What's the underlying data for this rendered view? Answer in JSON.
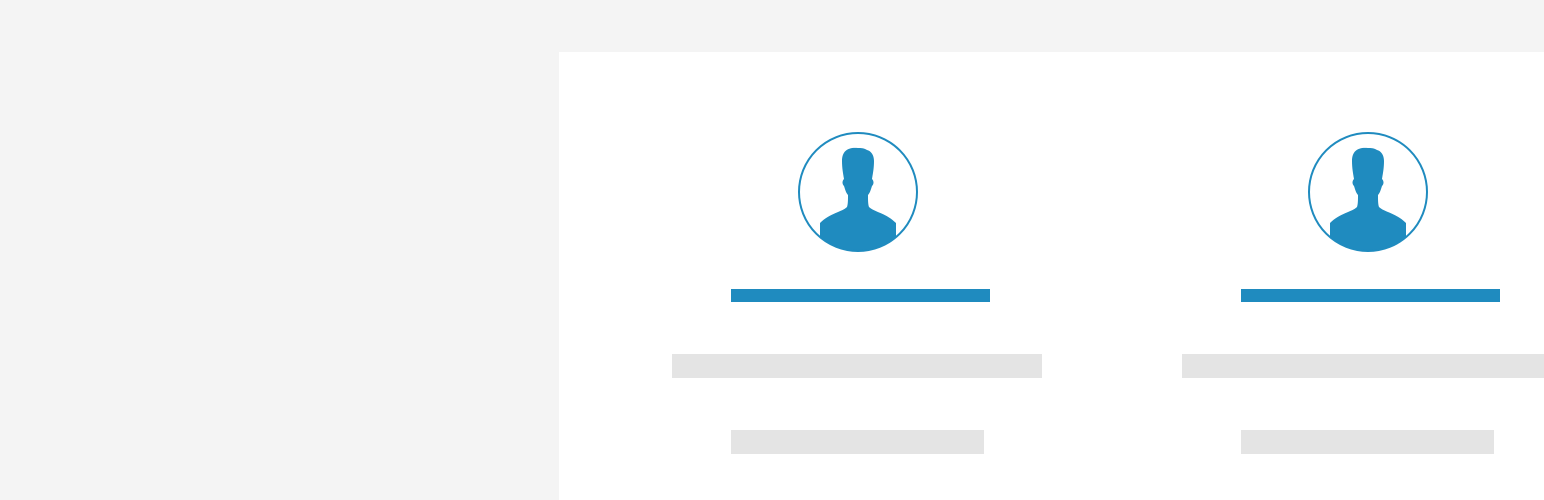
{
  "colors": {
    "page_background": "#f4f4f4",
    "panel_background": "#ffffff",
    "accent": "#1f8bbf",
    "placeholder": "#e4e4e4"
  },
  "cards": [
    {
      "avatar_icon": "user-silhouette-icon"
    },
    {
      "avatar_icon": "user-silhouette-icon"
    }
  ]
}
